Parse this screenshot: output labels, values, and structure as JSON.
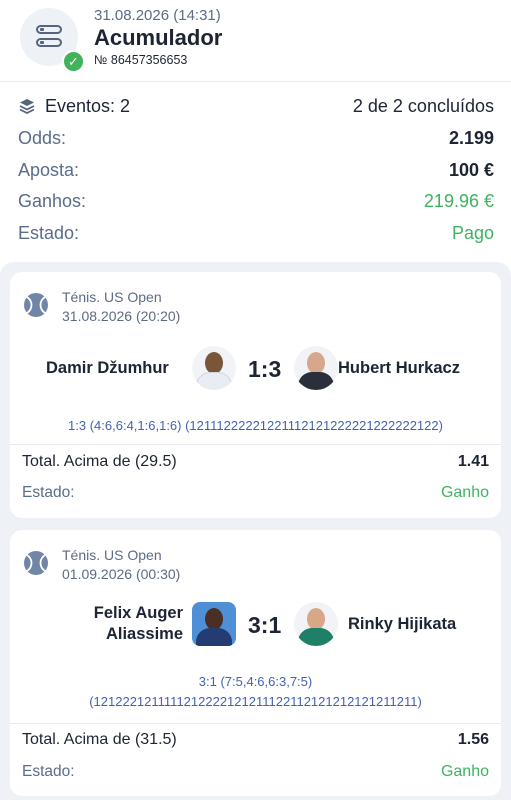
{
  "header": {
    "date": "31.08.2026 (14:31)",
    "title": "Acumulador",
    "ticket_number": "№ 86457356653"
  },
  "summary": {
    "events_label": "Eventos: 2",
    "events_status": "2 de 2 concluídos",
    "odds_label": "Odds:",
    "odds_value": "2.199",
    "stake_label": "Aposta:",
    "stake_value": "100 €",
    "winnings_label": "Ganhos:",
    "winnings_value": "219.96 €",
    "state_label": "Estado:",
    "state_value": "Pago"
  },
  "events": [
    {
      "league": "Ténis. US Open",
      "date": "31.08.2026 (20:20)",
      "player1": "Damir Džumhur",
      "player2": "Hubert Hurkacz",
      "score": "1:3",
      "sets": "1:3 (4:6,6:4,1:6,1:6) (12111222221221112121222221222222122)",
      "market": "Total. Acima de (29.5)",
      "odd": "1.41",
      "state_label": "Estado:",
      "state_value": "Ganho"
    },
    {
      "league": "Ténis. US Open",
      "date": "01.09.2026 (00:30)",
      "player1_line1": "Felix Auger",
      "player1_line2": "Aliassime",
      "player2": "Rinky Hijikata",
      "score": "3:1",
      "sets_line1": "3:1 (7:5,4:6,6:3,7:5)",
      "sets_line2": "(1212221211111212222121211122112121212121211211)",
      "market": "Total. Acima de (31.5)",
      "odd": "1.56",
      "state_label": "Estado:",
      "state_value": "Ganho"
    }
  ],
  "colors": {
    "accent_green": "#3fb360",
    "label_gray": "#5a6c8b",
    "link_blue": "#4262b0",
    "background": "#eef1f6"
  },
  "icons": [
    "bet-slip-icon",
    "check-icon",
    "layers-icon",
    "tennis-ball-icon"
  ]
}
